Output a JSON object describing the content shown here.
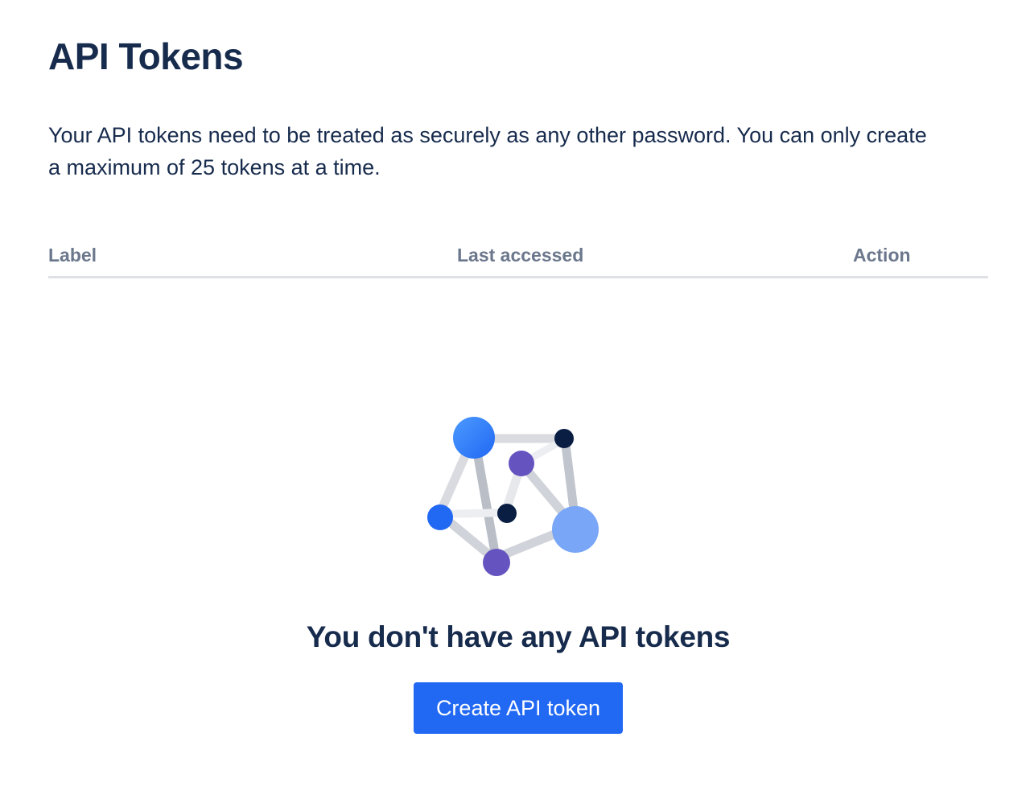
{
  "page": {
    "title": "API Tokens",
    "description": "Your API tokens need to be treated as securely as any other password. You can only create a maximum of 25 tokens at a time."
  },
  "table": {
    "columns": [
      "Label",
      "Last accessed",
      "Action"
    ],
    "rows": []
  },
  "empty_state": {
    "illustration": "network-nodes-illustration",
    "title": "You don't have any API tokens",
    "button_label": "Create API token"
  },
  "colors": {
    "text_primary": "#172b4d",
    "text_subtle": "#6b778c",
    "divider": "#dfe1e6",
    "button_primary": "#2168f3",
    "node_blue": "#2684ff",
    "node_light_blue": "#79a6f6",
    "node_purple": "#6554c0",
    "node_navy": "#091e42"
  }
}
